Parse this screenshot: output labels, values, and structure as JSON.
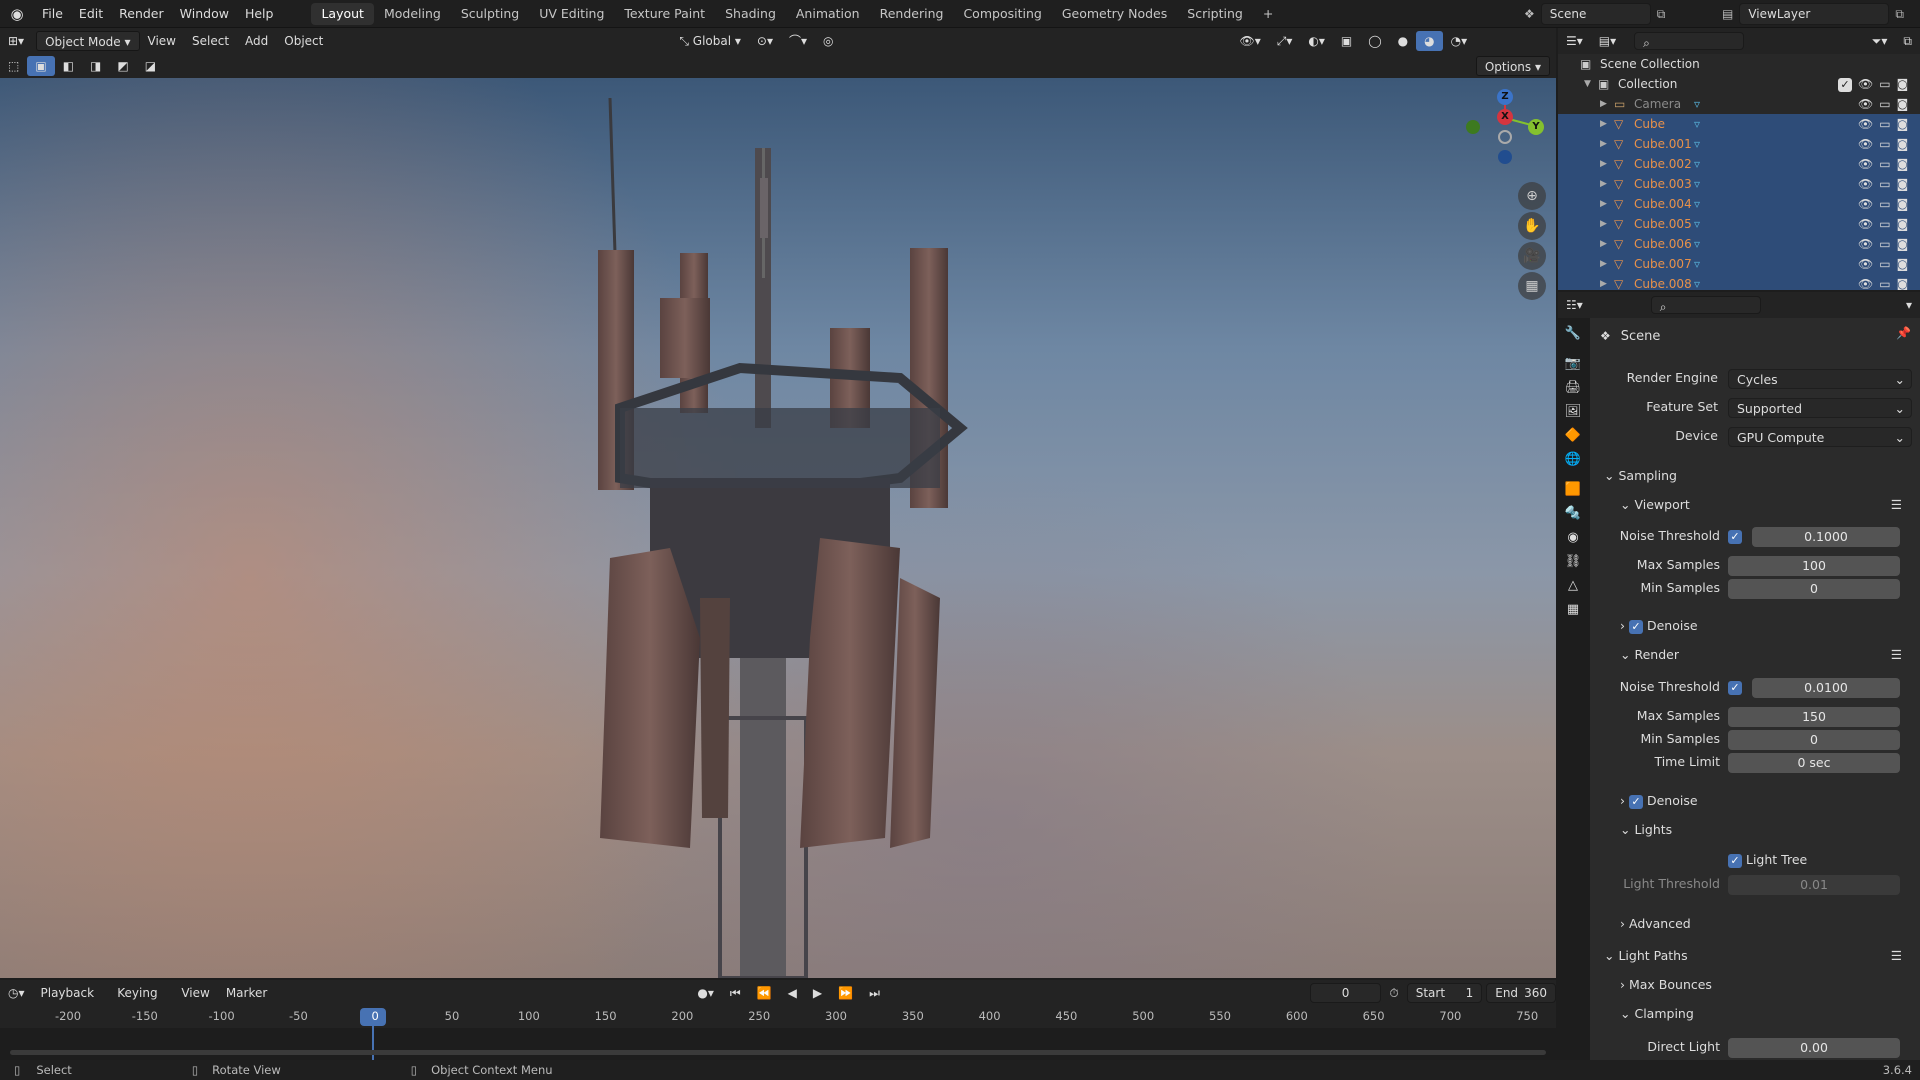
{
  "topbar": {
    "menus": [
      "File",
      "Edit",
      "Render",
      "Window",
      "Help"
    ],
    "workspaces": [
      "Layout",
      "Modeling",
      "Sculpting",
      "UV Editing",
      "Texture Paint",
      "Shading",
      "Animation",
      "Rendering",
      "Compositing",
      "Geometry Nodes",
      "Scripting"
    ],
    "active_workspace": "Layout",
    "add_tab": "+",
    "scene": "Scene",
    "view_layer": "ViewLayer"
  },
  "viewport_header": {
    "mode": "Object Mode",
    "menus": [
      "View",
      "Select",
      "Add",
      "Object"
    ],
    "orientation": "Global",
    "options": "Options"
  },
  "gizmo": {
    "x": "X",
    "y": "Y",
    "z": "Z"
  },
  "timeline": {
    "menus": [
      "Playback",
      "Keying",
      "View",
      "Marker"
    ],
    "current_frame": "0",
    "start_label": "Start",
    "start": "1",
    "end_label": "End",
    "end": "360",
    "ticks": [
      "-200",
      "-150",
      "-100",
      "-50",
      "0",
      "50",
      "100",
      "150",
      "200",
      "250",
      "300",
      "350",
      "400",
      "450",
      "500",
      "550",
      "600",
      "650",
      "700",
      "750"
    ]
  },
  "status": {
    "select": "Select",
    "rotate": "Rotate View",
    "context": "Object Context Menu",
    "version": "3.6.4"
  },
  "outliner": {
    "root": "Scene Collection",
    "collection": "Collection",
    "items": [
      "Camera",
      "Cube",
      "Cube.001",
      "Cube.002",
      "Cube.003",
      "Cube.004",
      "Cube.005",
      "Cube.006",
      "Cube.007",
      "Cube.008"
    ]
  },
  "properties": {
    "title": "Scene",
    "render_engine_label": "Render Engine",
    "render_engine": "Cycles",
    "feature_set_label": "Feature Set",
    "feature_set": "Supported",
    "device_label": "Device",
    "device": "GPU Compute",
    "sampling": "Sampling",
    "viewport": "Viewport",
    "noise_threshold_label": "Noise Threshold",
    "vp_noise_threshold": "0.1000",
    "max_samples_label": "Max Samples",
    "vp_max_samples": "100",
    "min_samples_label": "Min Samples",
    "vp_min_samples": "0",
    "denoise": "Denoise",
    "render": "Render",
    "r_noise_threshold": "0.0100",
    "r_max_samples": "150",
    "r_min_samples": "0",
    "time_limit_label": "Time Limit",
    "time_limit": "0 sec",
    "lights": "Lights",
    "light_tree": "Light Tree",
    "light_threshold_label": "Light Threshold",
    "light_threshold": "0.01",
    "advanced": "Advanced",
    "light_paths": "Light Paths",
    "max_bounces": "Max Bounces",
    "clamping": "Clamping",
    "direct_light_label": "Direct Light",
    "direct_light": "0.00"
  },
  "colors": {
    "accent": "#4772b3",
    "selected_row": "#2e4c78",
    "object_orange": "#e8914a",
    "x_axis": "#d4353f",
    "y_axis": "#84c12e",
    "z_axis": "#3b74c9"
  }
}
